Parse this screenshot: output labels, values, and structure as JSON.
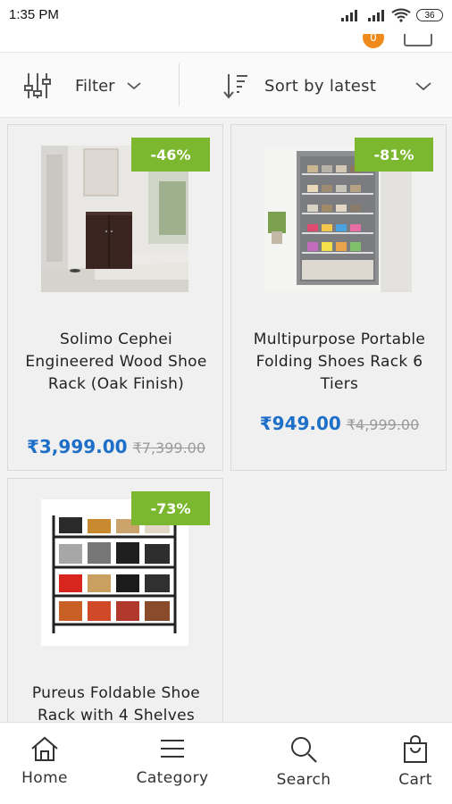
{
  "status": {
    "time": "1:35 PM",
    "battery": "36"
  },
  "header": {
    "cart_count": "0"
  },
  "toolbar": {
    "filter_label": "Filter",
    "sort_label": "Sort by latest"
  },
  "products": [
    {
      "discount": "-46%",
      "title": "Solimo Cephei Engineered Wood Shoe Rack (Oak Finish)",
      "price": "₹3,999.00",
      "old_price": "₹7,399.00"
    },
    {
      "discount": "-81%",
      "title": "Multipurpose Portable Folding Shoes Rack 6 Tiers",
      "price": "₹949.00",
      "old_price": "₹4,999.00"
    },
    {
      "discount": "-73%",
      "title": "Pureus Foldable Shoe Rack with 4 Shelves",
      "price": "",
      "old_price": ""
    }
  ],
  "nav": {
    "home": "Home",
    "category": "Category",
    "search": "Search",
    "cart": "Cart"
  },
  "colors": {
    "accent_price": "#1e6fc8",
    "discount_badge": "#7cb82f",
    "cart_badge": "#f08a1c"
  },
  "icons": {
    "filter": "sliders-icon",
    "sort": "sort-icon",
    "home": "home-icon",
    "category": "menu-icon",
    "search": "search-icon",
    "cart": "shopping-bag-icon"
  }
}
